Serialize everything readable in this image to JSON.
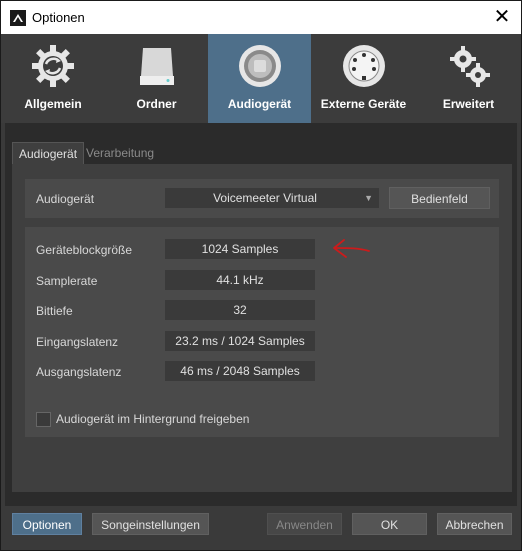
{
  "window": {
    "title": "Optionen",
    "close_symbol": "✕"
  },
  "nav": [
    {
      "label": "Allgemein",
      "icon": "gear-sync-icon"
    },
    {
      "label": "Ordner",
      "icon": "drive-icon"
    },
    {
      "label": "Audiogerät",
      "icon": "speaker-icon",
      "active": true
    },
    {
      "label": "Externe Geräte",
      "icon": "midi-din-icon"
    },
    {
      "label": "Erweitert",
      "icon": "gears-icon"
    }
  ],
  "tabs": {
    "active": "Audiogerät",
    "inactive": "Verarbeitung"
  },
  "device": {
    "label": "Audiogerät",
    "value": "Voicemeeter Virtual",
    "control_panel": "Bedienfeld"
  },
  "settings": [
    {
      "label": "Geräteblockgröße",
      "value": "1024 Samples"
    },
    {
      "label": "Samplerate",
      "value": "44.1 kHz"
    },
    {
      "label": "Bittiefe",
      "value": "32"
    },
    {
      "label": "Eingangslatenz",
      "value": "23.2 ms / 1024 Samples"
    },
    {
      "label": "Ausgangslatenz",
      "value": "46 ms / 2048 Samples"
    }
  ],
  "background_option": {
    "label": "Audiogerät im Hintergrund freigeben",
    "checked": false
  },
  "footer": {
    "options": "Optionen",
    "song_settings": "Songeinstellungen",
    "apply": "Anwenden",
    "ok": "OK",
    "cancel": "Abbrechen"
  },
  "colors": {
    "accent": "#4e6f8a",
    "annotation": "#cc1b1b"
  }
}
